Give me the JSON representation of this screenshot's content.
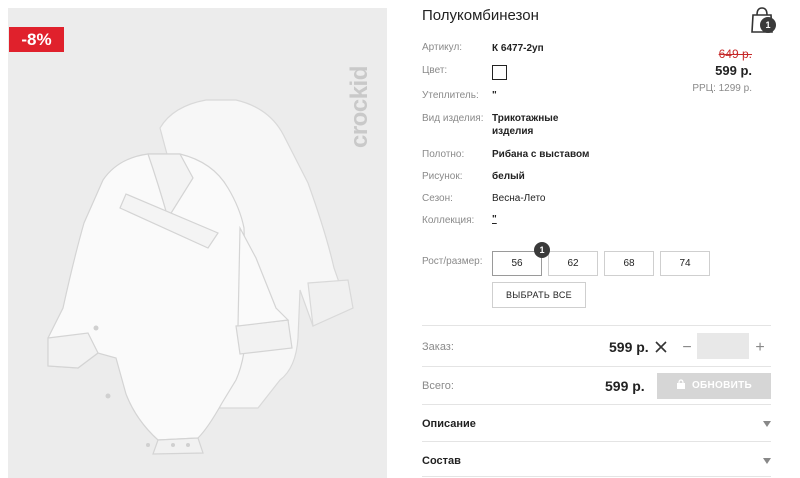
{
  "product": {
    "discount_badge": "-8%",
    "brand_logo_text": "crockid",
    "title": "Полукомбинезон"
  },
  "cart": {
    "icon": "shopping-bag-icon",
    "count": "1"
  },
  "attributes": [
    {
      "label": "Артикул:",
      "value": "К 6477-2уп"
    },
    {
      "label": "Цвет:",
      "value": ""
    },
    {
      "label": "Утеплитель:",
      "value": "\""
    },
    {
      "label": "Вид изделия:",
      "value": "Трикотажные изделия"
    },
    {
      "label": "Полотно:",
      "value": "Рибана с выставом"
    },
    {
      "label": "Рисунок:",
      "value": "белый"
    },
    {
      "label": "Сезон:",
      "value": "Весна-Лето"
    },
    {
      "label": "Коллекция:",
      "value": "\""
    }
  ],
  "color_swatch": "#ffffff",
  "prices": {
    "old": "649 р.",
    "current": "599 р.",
    "rrp": "РРЦ: 1299 р."
  },
  "sizes": {
    "label": "Рост/размер:",
    "options": [
      "56",
      "62",
      "68",
      "74"
    ],
    "selected": "56",
    "selected_count": "1",
    "select_all": "ВЫБРАТЬ ВСЕ"
  },
  "order": {
    "label": "Заказ:",
    "price": "599 р.",
    "quantity": "",
    "minus": "−",
    "plus": "+"
  },
  "total": {
    "label": "Всего:",
    "price": "599 р.",
    "update_button": "ОБНОВИТЬ"
  },
  "accordions": [
    {
      "title": "Описание"
    },
    {
      "title": "Состав"
    }
  ],
  "colors": {
    "discount": "#e0212c",
    "old_price": "#c62828",
    "update_button_bg": "#d6d6d6"
  }
}
